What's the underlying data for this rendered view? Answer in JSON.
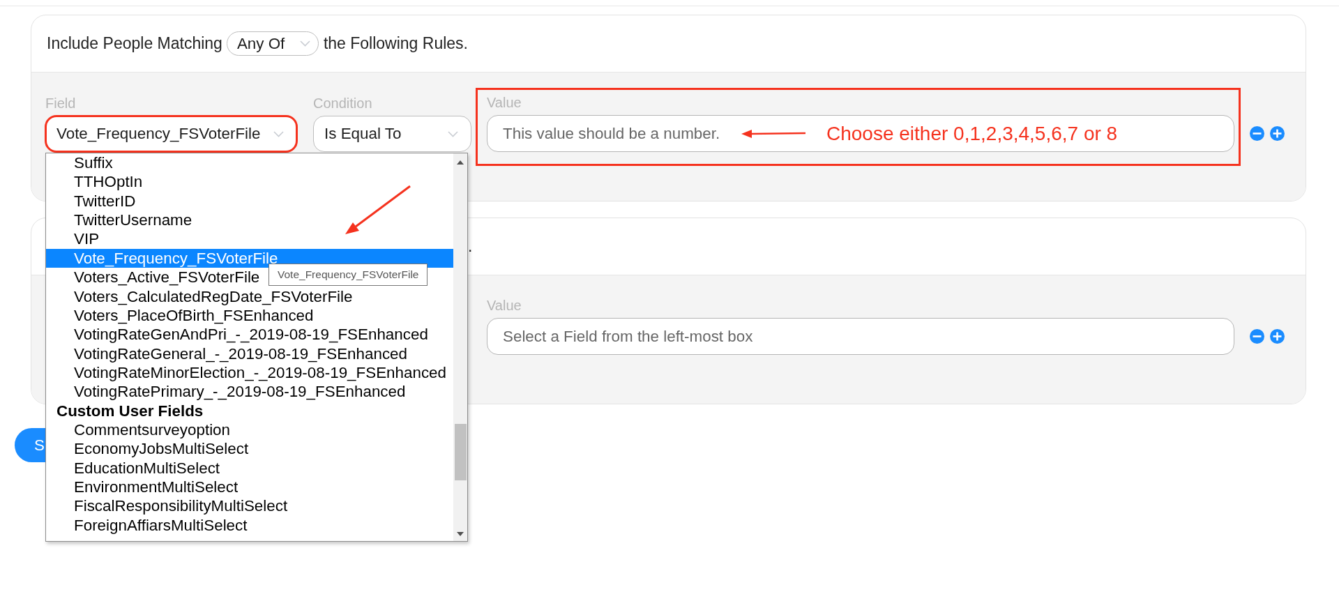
{
  "rule_groups": [
    {
      "header": {
        "prefix": "Include People Matching",
        "match_mode": "Any Of",
        "suffix": "the Following Rules."
      },
      "rule": {
        "field_label": "Field",
        "field_value": "Vote_Frequency_FSVoterFile",
        "field_annotated": true,
        "field_dropdown": {
          "selected_annotated": true,
          "tooltip": "Vote_Frequency_FSVoterFile",
          "groups": [
            {
              "options": [
                {
                  "label": "Suffix",
                  "selected": false
                },
                {
                  "label": "TTHOptIn",
                  "selected": false
                },
                {
                  "label": "TwitterID",
                  "selected": false
                },
                {
                  "label": "TwitterUsername",
                  "selected": false
                },
                {
                  "label": "VIP",
                  "selected": false
                },
                {
                  "label": "Vote_Frequency_FSVoterFile",
                  "selected": true
                },
                {
                  "label": "Voters_Active_FSVoterFile",
                  "selected": false
                },
                {
                  "label": "Voters_CalculatedRegDate_FSVoterFile",
                  "selected": false
                },
                {
                  "label": "Voters_PlaceOfBirth_FSEnhanced",
                  "selected": false
                },
                {
                  "label": "VotingRateGenAndPri_-_2019-08-19_FSEnhanced",
                  "selected": false
                },
                {
                  "label": "VotingRateGeneral_-_2019-08-19_FSEnhanced",
                  "selected": false
                },
                {
                  "label": "VotingRateMinorElection_-_2019-08-19_FSEnhanced",
                  "selected": false
                },
                {
                  "label": "VotingRatePrimary_-_2019-08-19_FSEnhanced",
                  "selected": false
                }
              ]
            },
            {
              "title": "Custom User Fields",
              "options": [
                {
                  "label": "Commentsurveyoption",
                  "selected": false
                },
                {
                  "label": "EconomyJobsMultiSelect",
                  "selected": false
                },
                {
                  "label": "EducationMultiSelect",
                  "selected": false
                },
                {
                  "label": "EnvironmentMultiSelect",
                  "selected": false
                },
                {
                  "label": "FiscalResponsibilityMultiSelect",
                  "selected": false
                },
                {
                  "label": "ForeignAffiarsMultiSelect",
                  "selected": false
                }
              ]
            }
          ]
        },
        "condition_label": "Condition",
        "condition_value": "Is Equal To",
        "value_label": "Value",
        "value_placeholder": "This value should be a number.",
        "value_annotated": true,
        "value_note": "Choose either 0,1,2,3,4,5,6,7 or 8"
      }
    },
    {
      "header": {
        "visible_tail": "."
      },
      "rule": {
        "value_label": "Value",
        "value_placeholder": "Select a Field from the left-most box"
      }
    }
  ],
  "save_button": {
    "label": "S"
  }
}
